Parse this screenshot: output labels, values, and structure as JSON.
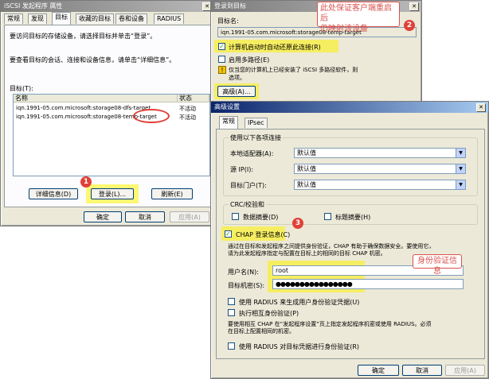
{
  "iscsi_props": {
    "title": "iSCSI 发起程序 属性",
    "close": "✕",
    "tabs": [
      "常规",
      "发现",
      "目标",
      "收藏的目标",
      "卷和设备",
      "RADIUS"
    ],
    "instruction1": "要访问目标的存储设备，请选择目标并单击“登录”。",
    "instruction2": "要查看目标的会话、连接和设备信息，请单击“详细信息”。",
    "targets_label": "目标(T):",
    "columns": [
      "名称",
      "状态"
    ],
    "rows": [
      {
        "name": "iqn.1991-05.com.microsoft:storage08-dfs-target",
        "status": "不活动"
      },
      {
        "name": "iqn.1991-05.com.microsoft:storage08-temp-target",
        "status": "不活动"
      }
    ],
    "details_btn": "详细信息(D)",
    "login_btn": "登录(L)...",
    "refresh_btn": "刷新(E)",
    "ok_btn": "确定",
    "cancel_btn": "取消",
    "apply_btn": "应用(A)"
  },
  "login_dialog": {
    "title": "登录到目标",
    "close": "✕",
    "target_name_label": "目标名:",
    "target_name_value": "iqn.1991-05.com.microsoft:storage08-temp-target",
    "auto_restore": "计算机启动时自动还原此连接(R)",
    "auto_restore_checked": true,
    "multipath": "启用多路径(E)",
    "multipath_checked": false,
    "warning_line1": "仅当您的计算机上已经安装了 iSCSI 多路径软件，则",
    "warning_line2": "选项。",
    "advanced_btn": "高级(A)..."
  },
  "advanced": {
    "title": "高级设置",
    "close": "✕",
    "tabs": [
      "常规",
      "IPsec"
    ],
    "connect_group": "使用以下各项连接",
    "local_adapter_label": "本地适配器(A):",
    "local_adapter_value": "默认值",
    "source_ip_label": "源 IP(I):",
    "source_ip_value": "默认值",
    "target_portal_label": "目标门户(T):",
    "target_portal_value": "默认值",
    "crc_group": "CRC/校验和",
    "data_digest": "数据摘要(D)",
    "header_digest": "标题摘要(H)",
    "chap": "CHAP 登录信息(C)",
    "chap_checked": true,
    "chap_desc1": "通过在目标和发起程序之间提供身份验证，CHAP 有助于确保数据安全。要使用它，",
    "chap_desc2": "请为此发起程序指定与配置在目标上的相同的目标 CHAP 机密。",
    "username_label": "用户名(N):",
    "username_value": "root",
    "secret_label": "目标机密(S):",
    "secret_value": "●●●●●●●●●●●●●●●●",
    "radius_user": "使用 RADIUS 来生成用户身份验证凭据(U)",
    "mutual_auth": "执行相互身份验证(P)",
    "mutual_desc1": "要使用相互 CHAP 在“发起程序设置”页上指定发起程序机密或使用 RADIUS。必须",
    "mutual_desc2": "在目标上配置相同的机密。",
    "radius_target": "使用 RADIUS 对目标凭据进行身份验证(R)",
    "ok_btn": "确定",
    "cancel_btn": "取消",
    "apply_btn": "应用(A)"
  },
  "annotations": {
    "callout_restore_line1": "此处保证客户端重启后",
    "callout_restore_line2": "仍映射该设备",
    "callout_auth": "身份验证信息",
    "n1": "1",
    "n2": "2",
    "n3": "3",
    "accent": "#e04038"
  }
}
